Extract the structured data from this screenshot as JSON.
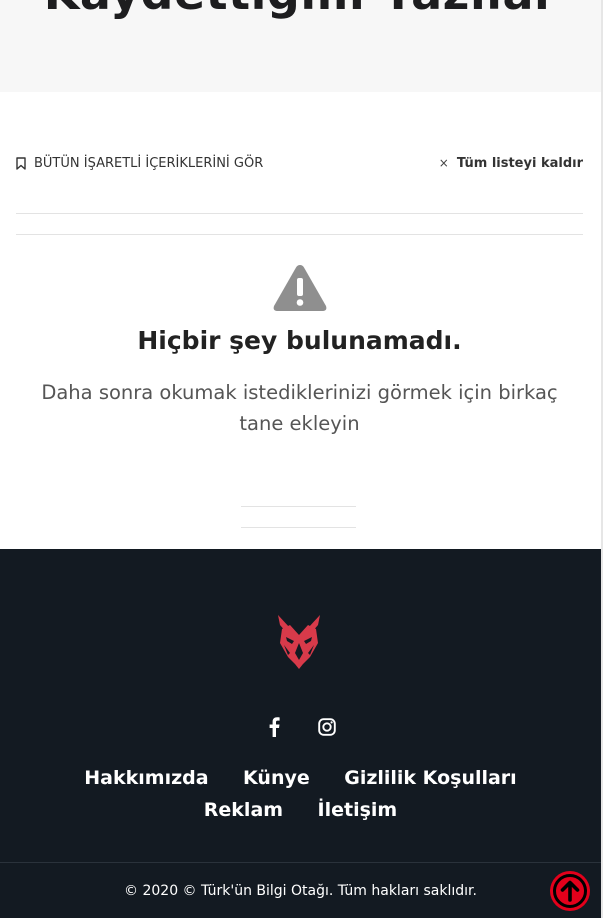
{
  "header": {
    "title": "Kaydettiğim Yazılar"
  },
  "toolbar": {
    "see_all_label": "BÜTÜN İŞARETLİ İÇERİKLERİNİ GÖR",
    "see_all_icon": "bookmark-icon",
    "clear_all_label": "Tüm listeyi kaldır",
    "clear_all_icon": "close-icon",
    "clear_all_glyph": "×"
  },
  "empty_state": {
    "icon": "warning-icon",
    "title": "Hiçbir şey bulunamadı.",
    "description": "Daha sonra okumak istediklerinizi görmek için birkaç tane ekleyin"
  },
  "footer": {
    "logo_icon": "wolf-logo-icon",
    "social": [
      {
        "icon": "facebook-icon"
      },
      {
        "icon": "instagram-icon"
      }
    ],
    "links": [
      "Hakkımızda",
      "Künye",
      "Gizlilik Koşulları",
      "Reklam",
      "İletişim"
    ],
    "copyright": "© 2020 © Türk'ün Bilgi Otağı. Tüm hakları saklıdır.",
    "to_top_icon": "arrow-up-icon"
  },
  "colors": {
    "brand_red": "#e3001b",
    "logo_red": "#d83a4a",
    "footer_bg": "#131a22",
    "title_band_bg": "#f7f7f7",
    "warning_gray": "#8f8f8f"
  }
}
